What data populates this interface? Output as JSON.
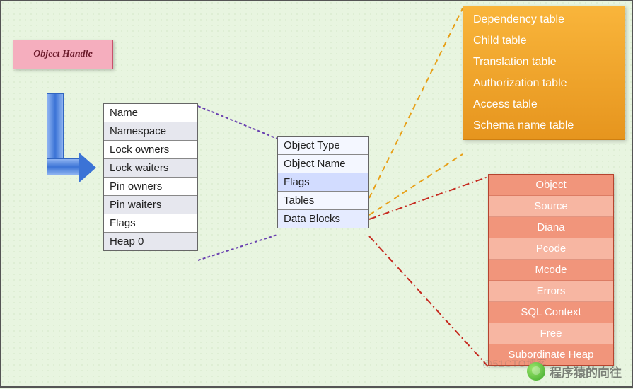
{
  "title": "Object  Handle",
  "main_table": [
    "Name",
    "Namespace",
    "Lock owners",
    "Lock waiters",
    "Pin owners",
    "Pin waiters",
    "Flags",
    "Heap 0"
  ],
  "mid_table": [
    "Object Type",
    "Object Name",
    "Flags",
    "Tables",
    "Data Blocks"
  ],
  "orange_list": [
    "Dependency table",
    "Child table",
    "Translation table",
    "Authorization table",
    "Access table",
    "Schema name table"
  ],
  "salmon_list": [
    "Object",
    "Source",
    "Diana",
    "Pcode",
    "Mcode",
    "Errors",
    "SQL Context",
    "Free",
    "Subordinate Heap"
  ],
  "watermark": "程序猿的向往",
  "wm2": "@51CTO博客"
}
